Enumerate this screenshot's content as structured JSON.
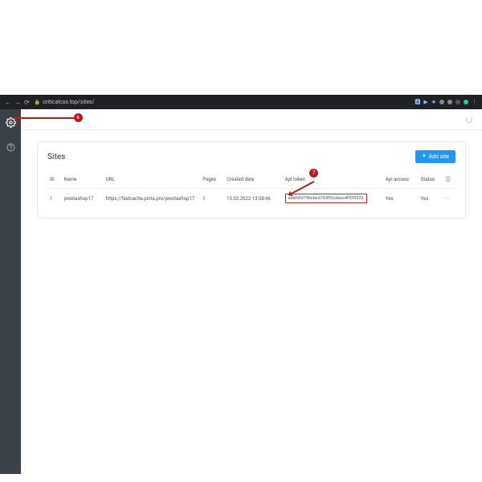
{
  "browser": {
    "url": "criticalcss.top/sites/"
  },
  "sidebar": {
    "items": [
      {
        "icon": "gear"
      },
      {
        "icon": "help"
      }
    ]
  },
  "page": {
    "title": "Sites",
    "add_button_label": "Add site"
  },
  "table": {
    "headers": {
      "id": "ID",
      "name": "Name",
      "url": "URL",
      "pages": "Pages",
      "created": "Created date",
      "token": "Api token",
      "api_access": "Api access",
      "status": "Status"
    },
    "rows": [
      {
        "id": "1",
        "name": "prestashop17",
        "url": "https://fastcache.pinta.pro/prestashop17",
        "pages": "1",
        "created": "15.02.2022 13:58:46",
        "token": "adafdfd79bcbcd76593cdacc4f935522",
        "api_access": "Yes",
        "status": "Yes",
        "actions": "···"
      }
    ]
  },
  "annotations": {
    "step_sidebar": "6",
    "step_token": "7"
  }
}
